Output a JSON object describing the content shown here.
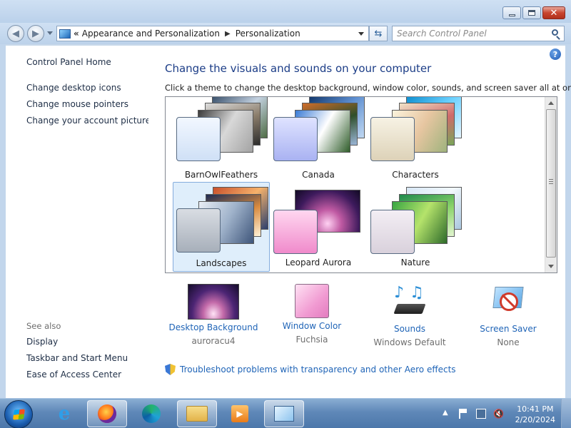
{
  "window": {
    "controls": {
      "minimize": "minimize",
      "maximize": "maximize",
      "close": "✕"
    }
  },
  "navigation": {
    "breadcrumb": [
      "Appearance and Personalization",
      "Personalization"
    ],
    "overflow_chevron": "«",
    "search_placeholder": "Search Control Panel"
  },
  "sidebar": {
    "home": "Control Panel Home",
    "links": [
      "Change desktop icons",
      "Change mouse pointers",
      "Change your account picture"
    ],
    "see_also_label": "See also",
    "see_also": [
      "Display",
      "Taskbar and Start Menu",
      "Ease of Access Center"
    ]
  },
  "main": {
    "heading": "Change the visuals and sounds on your computer",
    "subtitle": "Click a theme to change the desktop background, window color, sounds, and screen saver all at once.",
    "themes": [
      {
        "name": "BarnOwlFeathers",
        "selected": false
      },
      {
        "name": "Canada",
        "selected": false
      },
      {
        "name": "Characters",
        "selected": false
      },
      {
        "name": "Landscapes",
        "selected": true
      },
      {
        "name": "Leopard Aurora",
        "selected": false
      },
      {
        "name": "Nature",
        "selected": false
      }
    ],
    "settings": [
      {
        "label": "Desktop Background",
        "value": "auroracu4",
        "icon": "aurora-wallpaper-icon"
      },
      {
        "label": "Window Color",
        "value": "Fuchsia",
        "icon": "window-color-icon"
      },
      {
        "label": "Sounds",
        "value": "Windows Default",
        "icon": "sounds-icon"
      },
      {
        "label": "Screen Saver",
        "value": "None",
        "icon": "screen-saver-icon"
      }
    ],
    "troubleshoot_link": "Troubleshoot problems with transparency and other Aero effects"
  },
  "taskbar": {
    "apps": [
      "internet-explorer",
      "firefox",
      "edge",
      "file-explorer",
      "media-player",
      "control-panel"
    ],
    "time": "10:41 PM",
    "date": "2/20/2024"
  },
  "colors": {
    "link": "#1f64b7",
    "heading": "#1c3d87",
    "selection": "#dfeefb"
  }
}
